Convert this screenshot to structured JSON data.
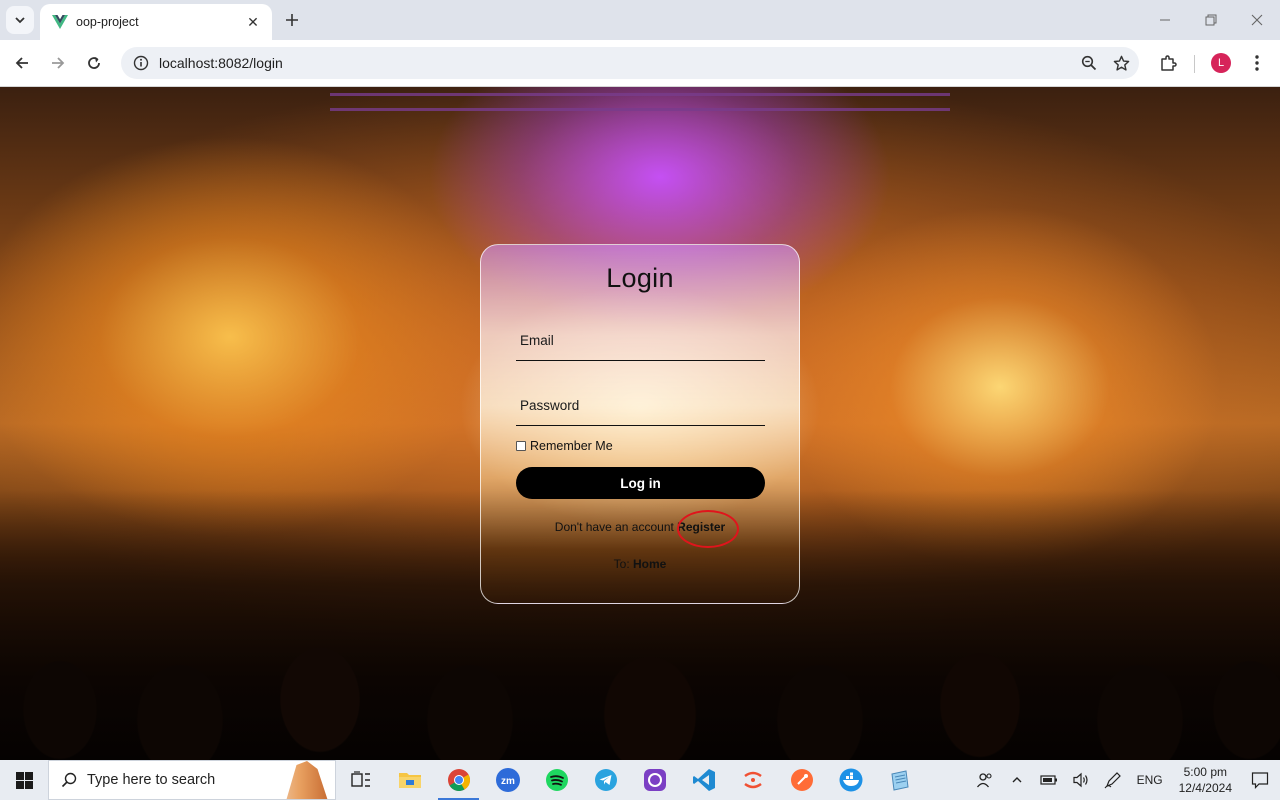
{
  "browser": {
    "tab_title": "oop-project",
    "url": "localhost:8082/login",
    "profile_initial": "L"
  },
  "login": {
    "title": "Login",
    "email_placeholder": "Email",
    "password_placeholder": "Password",
    "remember_label": "Remember Me",
    "login_button": "Log in",
    "no_account_text": "Don't have an account",
    "register_link": "Register",
    "to_text": "To:",
    "home_link": "Home"
  },
  "taskbar": {
    "search_placeholder": "Type here to search",
    "apps": [
      "task-view",
      "file-explorer",
      "chrome",
      "zoom",
      "spotify",
      "telegram",
      "github-desktop",
      "vscode",
      "git",
      "postman",
      "docker",
      "notepad"
    ],
    "language": "ENG",
    "time": "5:00 pm",
    "date": "12/4/2024"
  },
  "colors": {
    "annotation": "#e0141c",
    "button_bg": "#000000",
    "avatar": "#d6245a"
  }
}
